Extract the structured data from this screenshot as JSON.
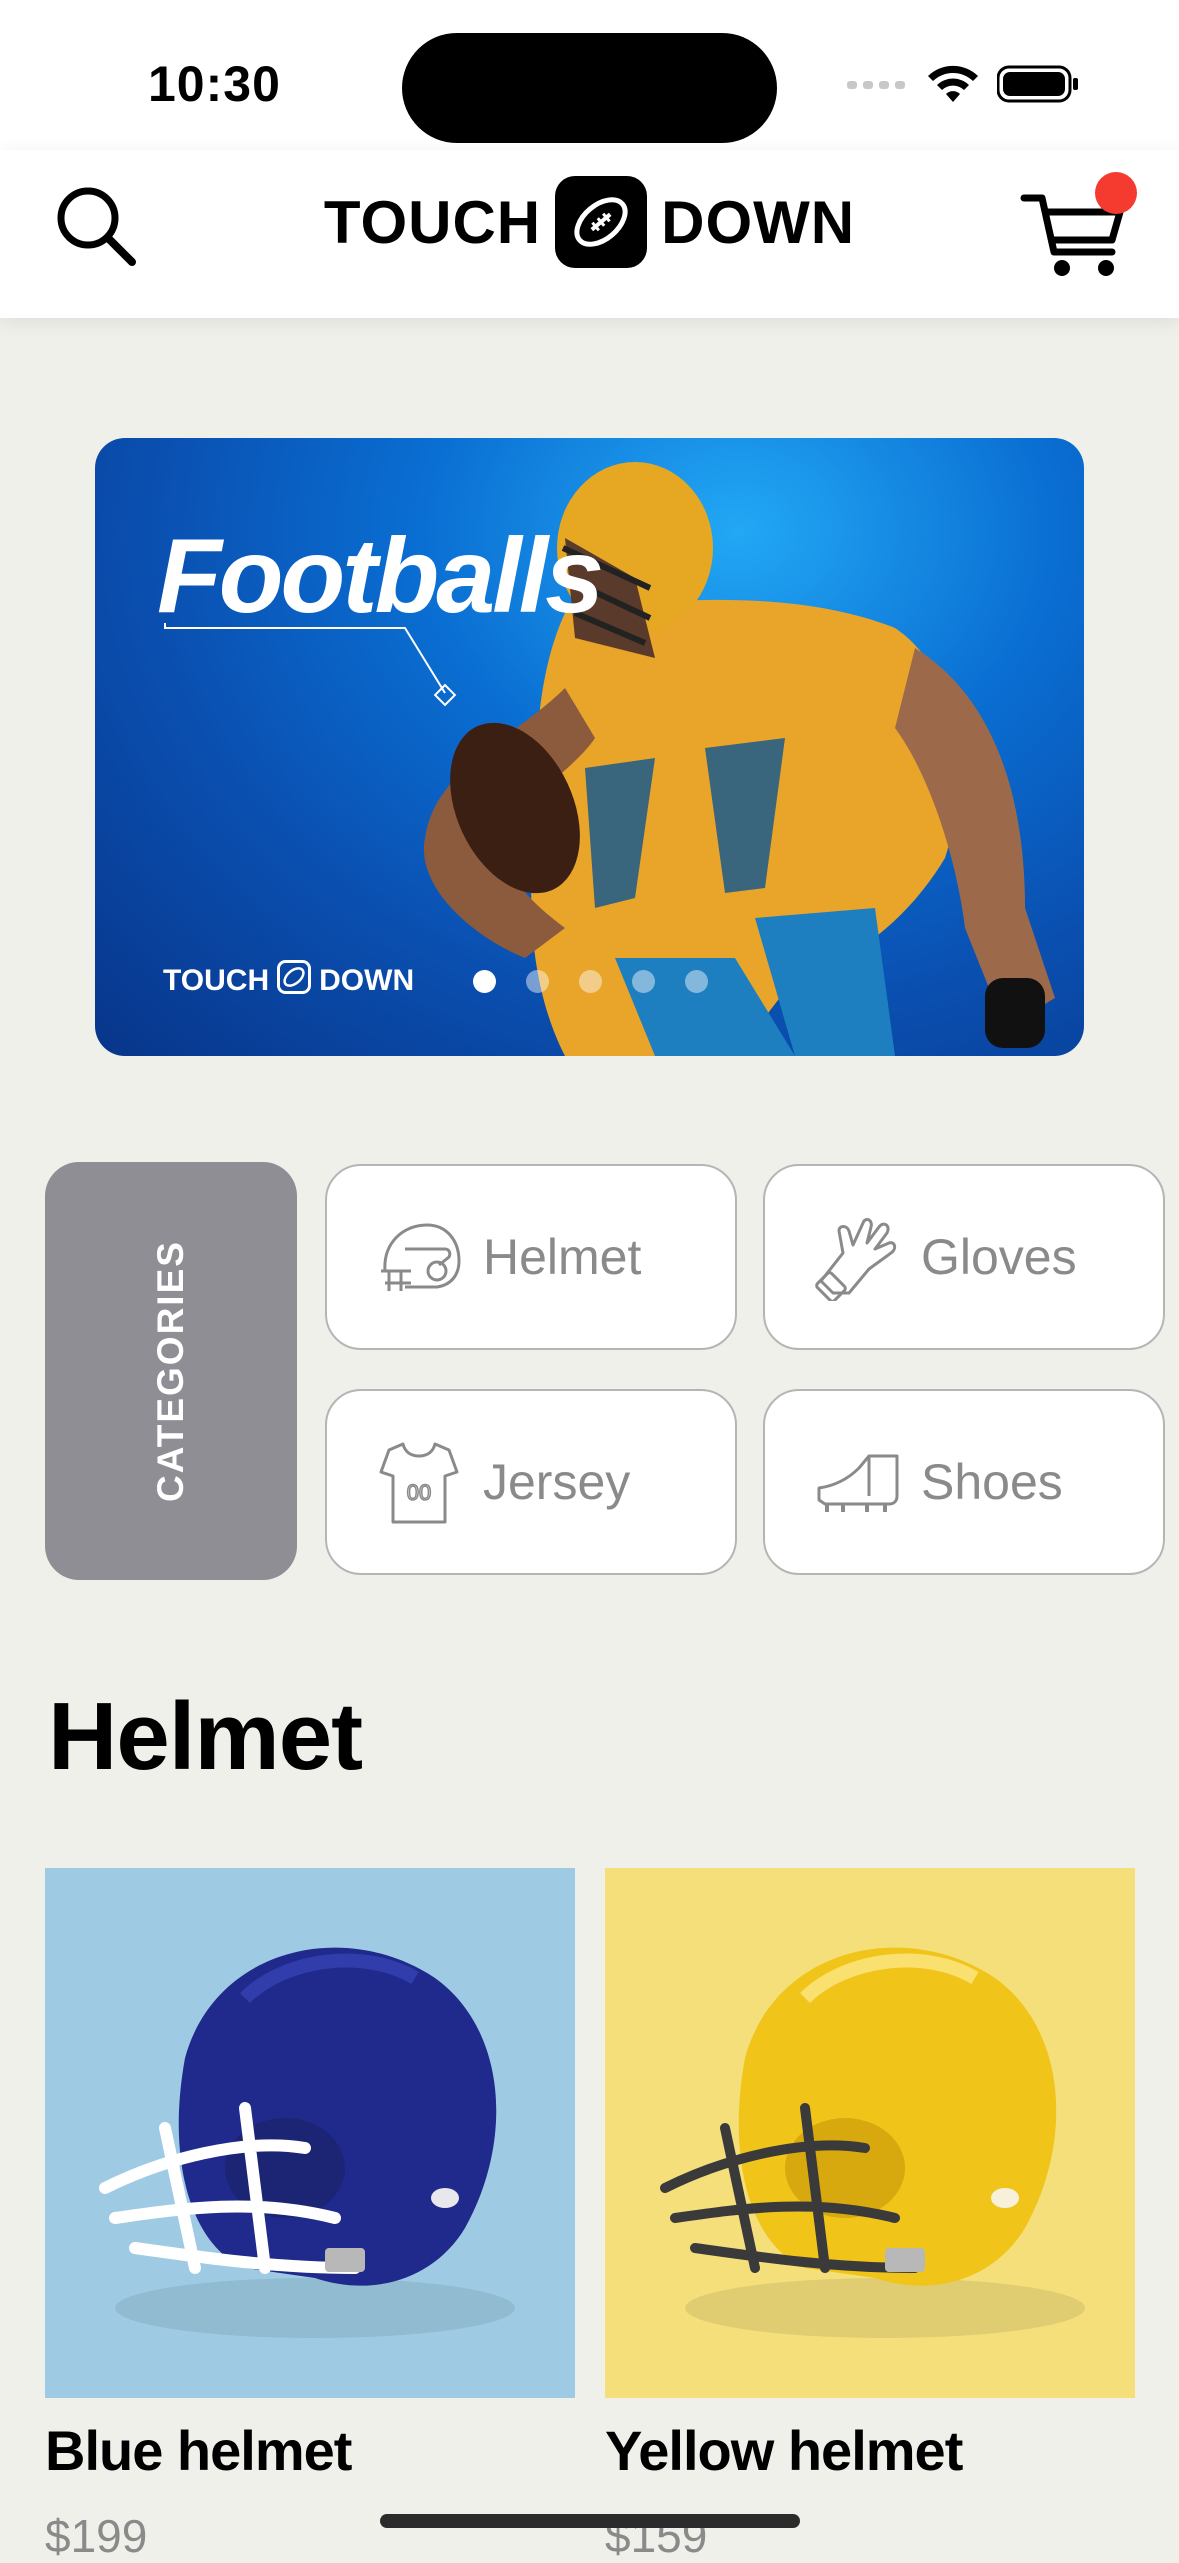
{
  "status_bar": {
    "time": "10:30"
  },
  "header": {
    "logo_left": "TOUCH",
    "logo_right": "DOWN"
  },
  "banner": {
    "title": "Footballs",
    "logo_left": "TOUCH",
    "logo_right": "DOWN",
    "slides_total": 5,
    "active_slide": 1
  },
  "categories": {
    "tab_label": "CATEGORIES",
    "items": [
      {
        "label": "Helmet",
        "icon": "helmet-icon"
      },
      {
        "label": "Gloves",
        "icon": "gloves-icon"
      },
      {
        "label": "Jersey",
        "icon": "jersey-icon"
      },
      {
        "label": "Shoes",
        "icon": "shoes-icon"
      }
    ]
  },
  "section": {
    "title": "Helmet"
  },
  "products": [
    {
      "name": "Blue helmet",
      "price": "$199",
      "bg": "#9ecbe3",
      "shell": "#1f2a8c"
    },
    {
      "name": "Yellow helmet",
      "price": "$159",
      "bg": "#f5df7b",
      "shell": "#f0c419"
    }
  ],
  "colors": {
    "badge": "#f53b30",
    "category_tab": "#8f8e94",
    "background": "#f0f0eb"
  }
}
